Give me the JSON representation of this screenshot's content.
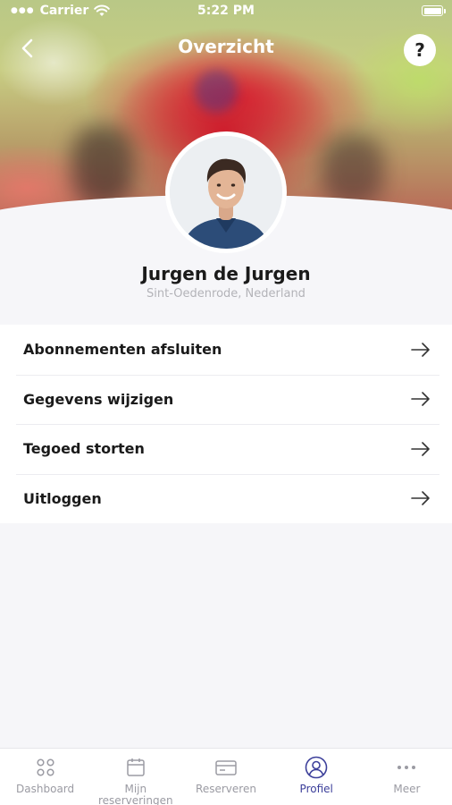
{
  "status_bar": {
    "carrier": "Carrier",
    "time": "5:22 PM"
  },
  "nav": {
    "title": "Overzicht",
    "help_label": "?"
  },
  "profile": {
    "name": "Jurgen de Jurgen",
    "location": "Sint-Oedenrode, Nederland"
  },
  "menu": {
    "items": [
      {
        "label": "Abonnementen afsluiten"
      },
      {
        "label": "Gegevens wijzigen"
      },
      {
        "label": "Tegoed storten"
      },
      {
        "label": "Uitloggen"
      }
    ]
  },
  "tabbar": {
    "tabs": [
      {
        "label": "Dashboard",
        "icon": "grid-icon"
      },
      {
        "label": "Mijn reserveringen",
        "icon": "calendar-icon"
      },
      {
        "label": "Reserveren",
        "icon": "card-icon"
      },
      {
        "label": "Profiel",
        "icon": "profile-icon"
      },
      {
        "label": "Meer",
        "icon": "more-icon"
      }
    ],
    "active_index": 3,
    "active_color": "#3c3f9a",
    "inactive_color": "#9b9ba3"
  }
}
